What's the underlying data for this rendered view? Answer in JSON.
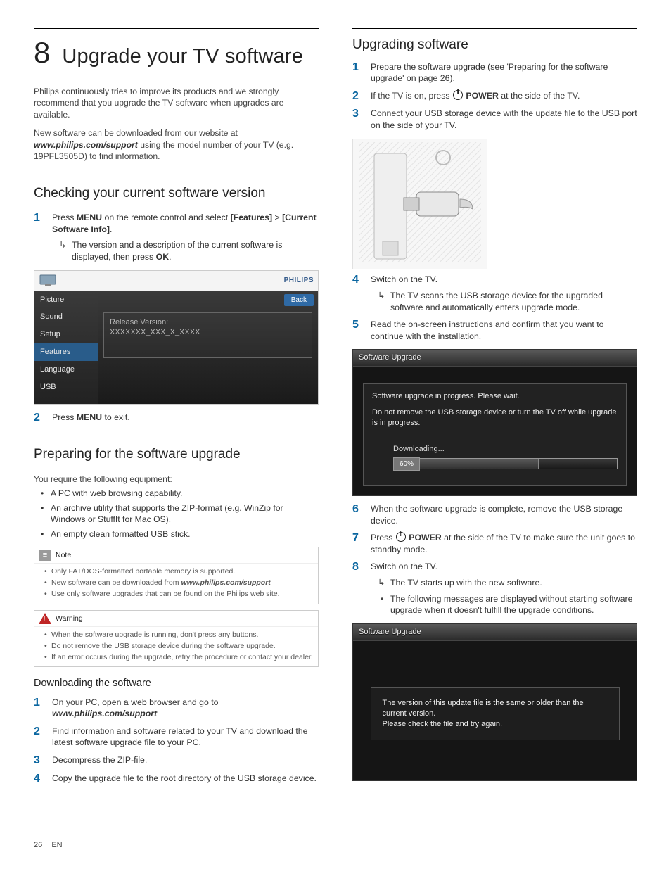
{
  "footer": {
    "page": "26",
    "lang": "EN"
  },
  "left": {
    "chapter_num": "8",
    "chapter_title": "Upgrade your TV software",
    "intro1": "Philips continuously tries to improve its products and we strongly recommend that you upgrade the TV software when upgrades are available.",
    "intro2_a": "New software can be downloaded from our website at ",
    "intro2_b": "www.philips.com/support",
    "intro2_c": " using the model number of your TV (e.g. 19PFL3505D) to find information.",
    "sec_check_h": "Checking your current software version",
    "check_step1_a": "Press ",
    "check_step1_menu": "MENU",
    "check_step1_b": " on the remote control and select ",
    "check_step1_feat": "[Features]",
    "check_step1_c": " > ",
    "check_step1_csi": "[Current Software Info]",
    "check_step1_d": ".",
    "check_step1_sub_a": "The version and a description of the current software is displayed, then press ",
    "check_step1_sub_ok": "OK",
    "check_step1_sub_b": ".",
    "tvshot": {
      "brand": "PHILIPS",
      "menu": [
        "Picture",
        "Sound",
        "Setup",
        "Features",
        "Language",
        "USB"
      ],
      "selected": "Features",
      "back": "Back",
      "panel_l1": "Release Version:",
      "panel_l2": "XXXXXXX_XXX_X_XXXX"
    },
    "check_step2_a": "Press ",
    "check_step2_menu": "MENU",
    "check_step2_b": " to exit.",
    "sec_prep_h": "Preparing for the software upgrade",
    "prep_lead": "You require the following equipment:",
    "prep_b1": "A PC with web browsing capability.",
    "prep_b2": "An archive utility that supports the ZIP-format (e.g. WinZip for Windows or StuffIt for Mac OS).",
    "prep_b3": "An empty clean formatted USB stick.",
    "note_h": "Note",
    "note_i1": "Only FAT/DOS-formatted portable memory is supported.",
    "note_i2_a": "New software can be downloaded from ",
    "note_i2_b": "www.philips.com/support",
    "note_i3": "Use only software upgrades that can be found on the Philips web site.",
    "warn_h": "Warning",
    "warn_i1": "When the software upgrade is running, don't press any buttons.",
    "warn_i2": "Do not remove the USB storage device during the software upgrade.",
    "warn_i3": "If an error occurs during the upgrade, retry the procedure or contact your dealer.",
    "dl_h": "Downloading the software",
    "dl_s1_a": "On your PC, open a web browser and go to ",
    "dl_s1_b": "www.philips.com/support",
    "dl_s2": "Find information and software related to your TV and download the latest software upgrade file to your PC.",
    "dl_s3": "Decompress the ZIP-file.",
    "dl_s4": "Copy the upgrade file to the root directory of the USB storage device."
  },
  "right": {
    "sec_up_h": "Upgrading software",
    "s1": "Prepare the software upgrade (see 'Preparing for the software upgrade' on page 26).",
    "s2_a": "If the TV is on, press ",
    "s2_pwr": "POWER",
    "s2_b": " at the side of the TV.",
    "s3": "Connect your USB storage device with the update file to the USB port on the side of your TV.",
    "s4": "Switch on the TV.",
    "s4_sub": "The TV scans the USB storage device for the upgraded software and automatically enters upgrade mode.",
    "s5": "Read the on-screen instructions and confirm that you want to continue with the installation.",
    "swu1": {
      "title": "Software Upgrade",
      "l1": "Software upgrade in progress. Please wait.",
      "l2": "Do not remove the USB storage device or turn the TV off while upgrade is in progress.",
      "dl": "Downloading...",
      "pct": "60%"
    },
    "s6": "When the software upgrade is complete, remove the USB storage device.",
    "s7_a": "Press ",
    "s7_pwr": "POWER",
    "s7_b": " at the side of the TV to make sure the unit goes to standby mode.",
    "s8": "Switch on the TV.",
    "s8_sub1": "The TV starts up with the new software.",
    "s8_sub2": "The following messages are displayed without starting software upgrade when it doesn't fulfill the upgrade conditions.",
    "swu2": {
      "title": "Software Upgrade",
      "m1": "The version of this update file is the same or older than the current version.",
      "m2": "Please check the file and try again."
    }
  },
  "chart_data": {
    "type": "bar",
    "title": "Software Upgrade Download Progress",
    "categories": [
      "Downloading"
    ],
    "values": [
      60
    ],
    "ylim": [
      0,
      100
    ],
    "xlabel": "",
    "ylabel": "%"
  }
}
